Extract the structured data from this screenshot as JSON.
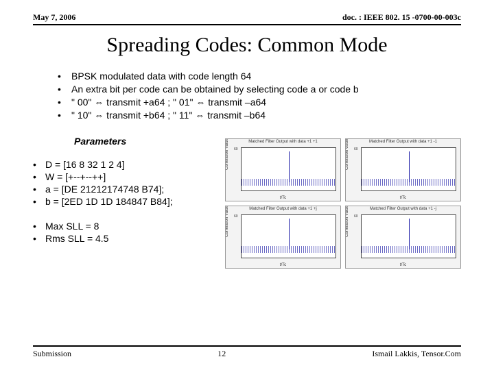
{
  "header": {
    "left": "May 7, 2006",
    "right": "doc. : IEEE 802. 15 -0700-00-003c"
  },
  "title": "Spreading Codes: Common Mode",
  "bullets_top": [
    "BPSK modulated data with code length 64",
    "An extra bit per code can be obtained by selecting code a or code b",
    "\" 00\"  ⇔  transmit +a64  ;   \" 01\"  ⇔  transmit –a64",
    "\" 10\"  ⇔  transmit +b64 ;   \" 11\"  ⇔  transmit –b64"
  ],
  "params_label": "Parameters",
  "params": [
    "D  = [16 8 32 1 2 4]",
    "W = [+--+--++]",
    "a  = [DE 21212174748 B74];",
    "b  = [2ED 1D 1D 184847 B84];"
  ],
  "stats": [
    "Max SLL = 8",
    "Rms SLL = 4.5"
  ],
  "charts": [
    {
      "title": "Matched Filter Output with data +1 +1",
      "yl": "Correlation Value",
      "xl": "t/Tc",
      "ymax": "60"
    },
    {
      "title": "Matched Filter Output with data +1 -1",
      "yl": "Correlation value",
      "xl": "t/Tc",
      "ymax": "60"
    },
    {
      "title": "Matched Filter Output with data +1 +j",
      "yl": "Correlation Value",
      "xl": "t/Tc",
      "ymax": "60"
    },
    {
      "title": "Matched Filter Output with data +1 -j",
      "yl": "Correlation Value",
      "xl": "t/Tc",
      "ymax": "60"
    }
  ],
  "footer": {
    "left": "Submission",
    "center": "12",
    "right": "Ismail Lakkis, Tensor.Com"
  }
}
